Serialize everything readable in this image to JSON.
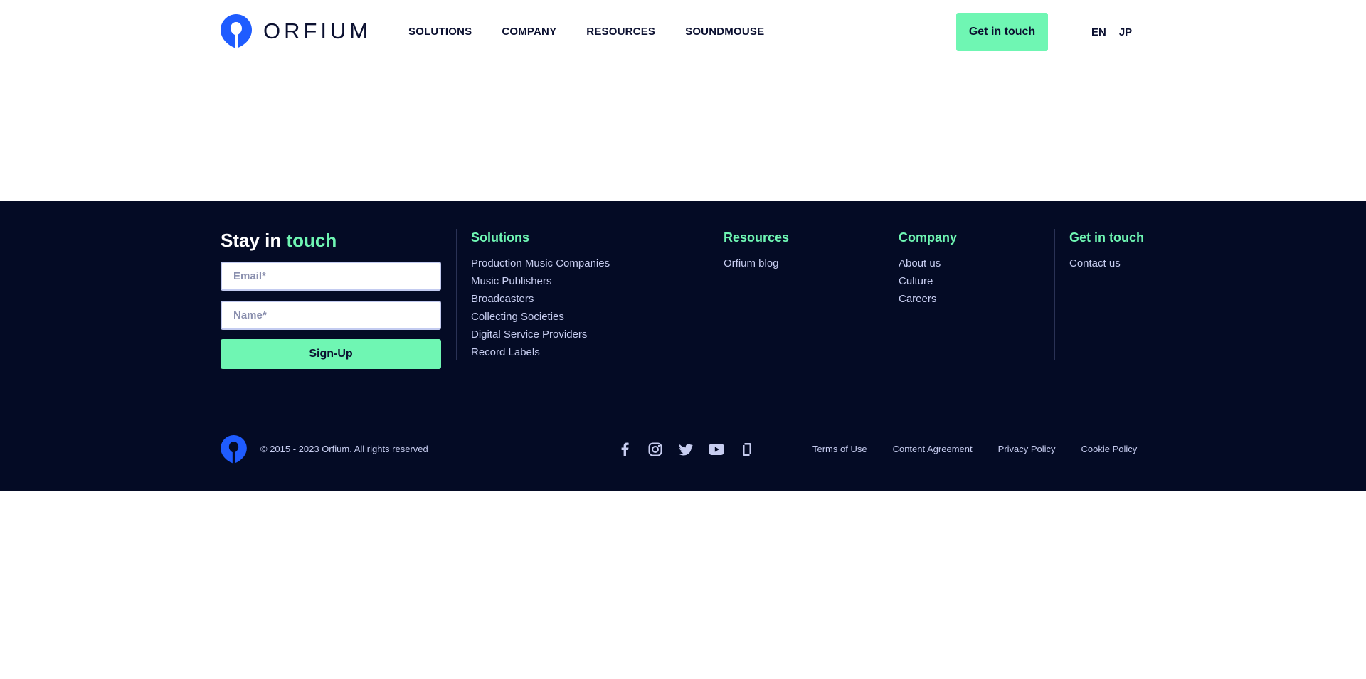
{
  "brand": {
    "name": "ORFIUM",
    "logo_color": "#1f5cff",
    "accent": "#6ff6b3",
    "footer_bg": "#040b25"
  },
  "nav": {
    "items": [
      {
        "label": "SOLUTIONS"
      },
      {
        "label": "COMPANY"
      },
      {
        "label": "RESOURCES"
      },
      {
        "label": "SOUNDMOUSE"
      }
    ],
    "cta_label": "Get in touch",
    "languages": [
      {
        "label": "EN"
      },
      {
        "label": "JP"
      }
    ]
  },
  "footer": {
    "stay": {
      "title_main": "Stay in ",
      "title_accent": "touch",
      "email_placeholder": "Email*",
      "name_placeholder": "Name*",
      "signup_label": "Sign-Up"
    },
    "columns": [
      {
        "title": "Solutions",
        "links": [
          "Production Music Companies",
          "Music Publishers",
          "Broadcasters",
          "Collecting Societies",
          "Digital Service Providers",
          "Record Labels"
        ]
      },
      {
        "title": "Resources",
        "links": [
          "Orfium blog"
        ]
      },
      {
        "title": "Company",
        "links": [
          "About us",
          "Culture",
          "Careers"
        ]
      },
      {
        "title": "Get in touch",
        "links": [
          "Contact us"
        ]
      }
    ],
    "copyright": "© 2015 - 2023 Orfium. All rights reserved",
    "socials": [
      {
        "icon": "facebook-icon"
      },
      {
        "icon": "instagram-icon"
      },
      {
        "icon": "twitter-icon"
      },
      {
        "icon": "youtube-icon"
      },
      {
        "icon": "glassdoor-icon"
      }
    ],
    "legal": [
      {
        "label": "Terms of Use"
      },
      {
        "label": "Content Agreement"
      },
      {
        "label": "Privacy Policy"
      },
      {
        "label": "Cookie Policy"
      }
    ]
  }
}
